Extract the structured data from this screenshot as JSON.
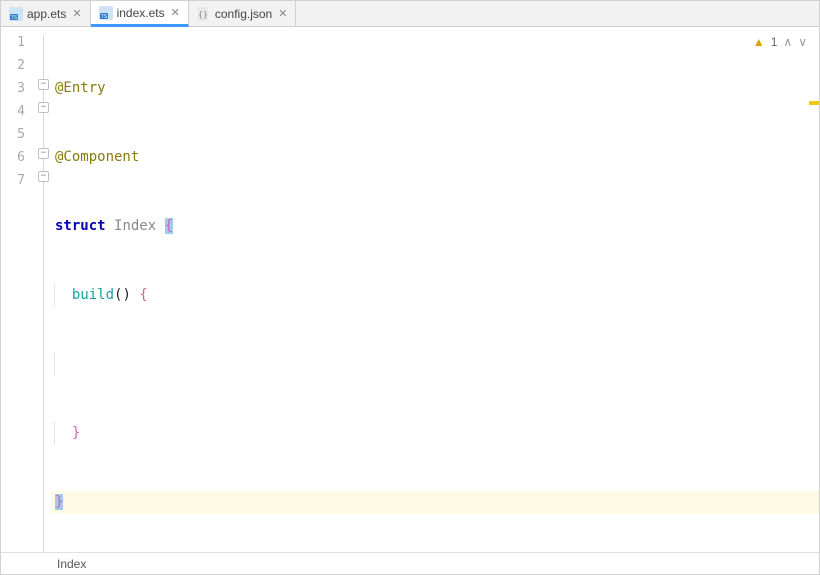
{
  "tabs": [
    {
      "label": "app.ets",
      "icon": "ts-file",
      "active": false
    },
    {
      "label": "index.ets",
      "icon": "ts-file",
      "active": true
    },
    {
      "label": "config.json",
      "icon": "json-file",
      "active": false
    }
  ],
  "gutter": {
    "lines": [
      "1",
      "2",
      "3",
      "4",
      "5",
      "6",
      "7"
    ]
  },
  "code": {
    "l1": {
      "decorator": "@Entry"
    },
    "l2": {
      "decorator": "@Component"
    },
    "l3": {
      "kw": "struct",
      "type": "Index",
      "brace_open": "{"
    },
    "l4": {
      "method": "build",
      "parens": "()",
      "brace_open": "{"
    },
    "l5": {
      "blank": ""
    },
    "l6": {
      "brace_close": "}"
    },
    "l7": {
      "brace_close": "}"
    }
  },
  "inspection": {
    "count": "1"
  },
  "breadcrumb": {
    "path": "Index"
  }
}
